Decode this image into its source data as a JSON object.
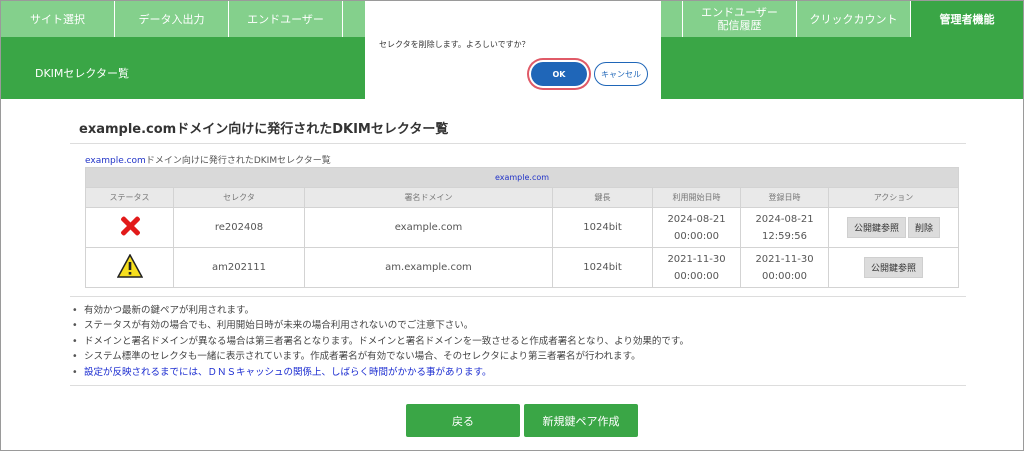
{
  "nav": {
    "tabs": [
      {
        "label": "サイト選択"
      },
      {
        "label": "データ入出力"
      },
      {
        "label": "エンドユーザー"
      },
      {
        "label": ""
      },
      {
        "label": "エンドユーザー\n配信履歴"
      },
      {
        "label": "クリックカウント"
      },
      {
        "label": "管理者機能"
      }
    ]
  },
  "band": {
    "title": "DKIMセレクター覧"
  },
  "dialog": {
    "message": "セレクタを削除します。よろしいですか？",
    "ok_label": "OK",
    "cancel_label": "キャンセル"
  },
  "page": {
    "heading": "example.comドメイン向けに発行されたDKIMセレクター覧",
    "caption_domain": "example.com",
    "caption_rest": "ドメイン向けに発行されたDKIMセレクター覧"
  },
  "table": {
    "domain": "example.com",
    "headers": [
      "ステータス",
      "セレクタ",
      "署名ドメイン",
      "鍵長",
      "利用開始日時",
      "登録日時",
      "アクション"
    ],
    "rows": [
      {
        "status_icon": "error-x-icon",
        "selector": "re202408",
        "sign_domain": "example.com",
        "key_length": "1024bit",
        "start_date": "2024-08-21",
        "start_time": "00:00:00",
        "reg_date": "2024-08-21",
        "reg_time": "12:59:56",
        "action1": "公開鍵参照",
        "action2": "削除"
      },
      {
        "status_icon": "warning-icon",
        "selector": "am202111",
        "sign_domain": "am.example.com",
        "key_length": "1024bit",
        "start_date": "2021-11-30",
        "start_time": "00:00:00",
        "reg_date": "2021-11-30",
        "reg_time": "00:00:00",
        "action1": "公開鍵参照"
      }
    ]
  },
  "notes": [
    "有効かつ最新の鍵ペアが利用されます。",
    "ステータスが有効の場合でも、利用開始日時が未来の場合利用されないのでご注意下さい。",
    "ドメインと署名ドメインが異なる場合は第三者署名となります。ドメインと署名ドメインを一致させると作成者署名となり、より効果的です。",
    "システム標準のセレクタも一緒に表示されています。作成者署名が有効でない場合、そのセレクタにより第三者署名が行われます。",
    "設定が反映されるまでには、ＤＮＳキャッシュの関係上、しばらく時間がかかる事があります。"
  ],
  "buttons": {
    "back": "戻る",
    "new_pair": "新規鍵ペア作成"
  },
  "colors": {
    "green": "#3aa646",
    "light_green": "#84d08c",
    "ok_blue": "#1f66b8",
    "error_red": "#e21a1a",
    "warning_yellow": "#f7df1e"
  }
}
